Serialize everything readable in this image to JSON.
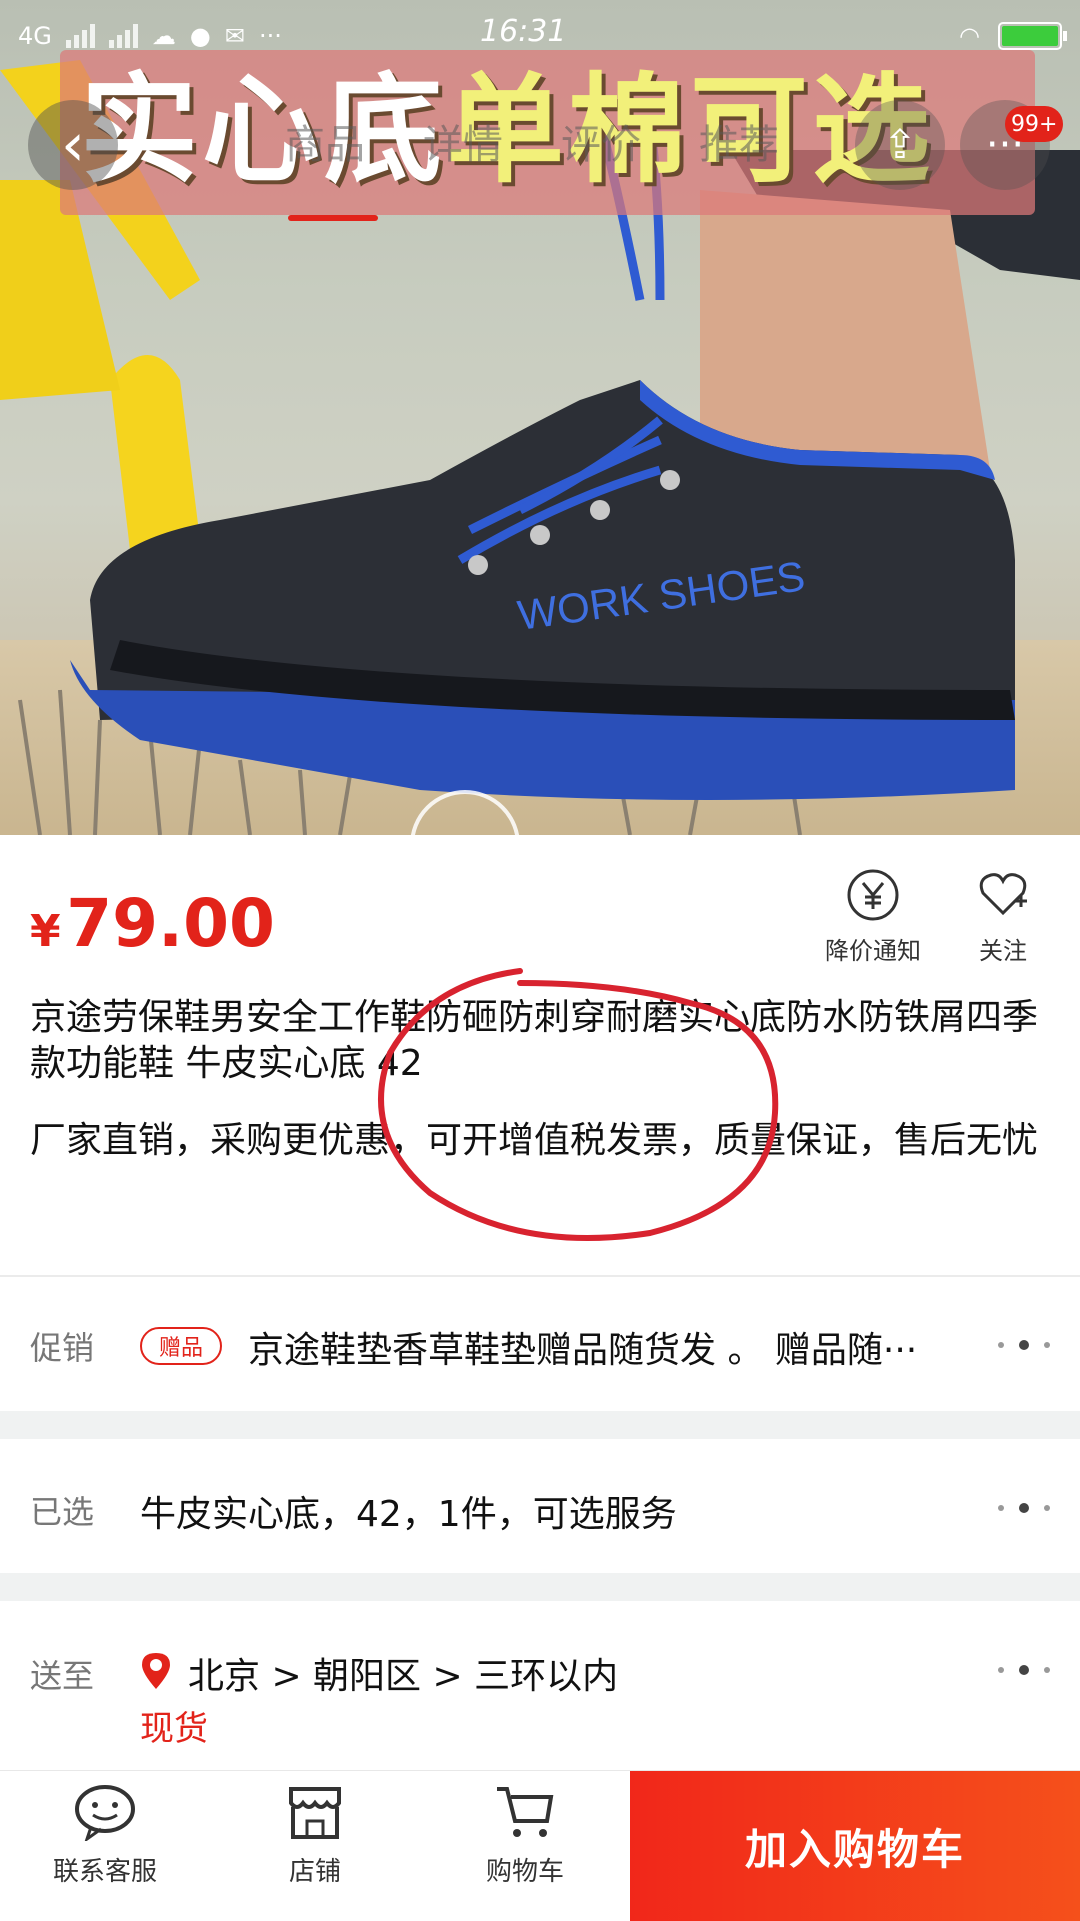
{
  "status_bar": {
    "network": "4G",
    "time": "16:31",
    "more": "···"
  },
  "banner": {
    "part1": "实心底",
    "part2": "单棉可选"
  },
  "nav": {
    "tabs": [
      {
        "label": "商品"
      },
      {
        "label": "详情"
      },
      {
        "label": "评价"
      },
      {
        "label": "推荐"
      }
    ],
    "cart_badge": "99+"
  },
  "product_image": {
    "shoe_text": "WORK SHOES"
  },
  "product": {
    "currency": "¥",
    "price": "79.00",
    "title": "京途劳保鞋男安全工作鞋防砸防刺穿耐磨实心底防水防铁屑四季款功能鞋 牛皮实心底 42",
    "description": "厂家直销，采购更优惠，可开增值税发票，质量保证，售后无忧",
    "actions": {
      "price_alert": "降价通知",
      "follow": "关注"
    }
  },
  "promo": {
    "label": "促销",
    "tag": "赠品",
    "text": "京途鞋垫香草鞋垫赠品随货发 。 赠品随···"
  },
  "selected": {
    "label": "已选",
    "text": "牛皮实心底，42，1件，可选服务"
  },
  "delivery": {
    "label": "送至",
    "address": "北京 > 朝阳区 > 三环以内",
    "stock": "现货"
  },
  "bottom_bar": {
    "service": "联系客服",
    "store": "店铺",
    "cart": "购物车",
    "add_to_cart": "加入购物车"
  },
  "colors": {
    "accent": "#e2231a",
    "add_to_cart_bg": "#f1271a"
  }
}
